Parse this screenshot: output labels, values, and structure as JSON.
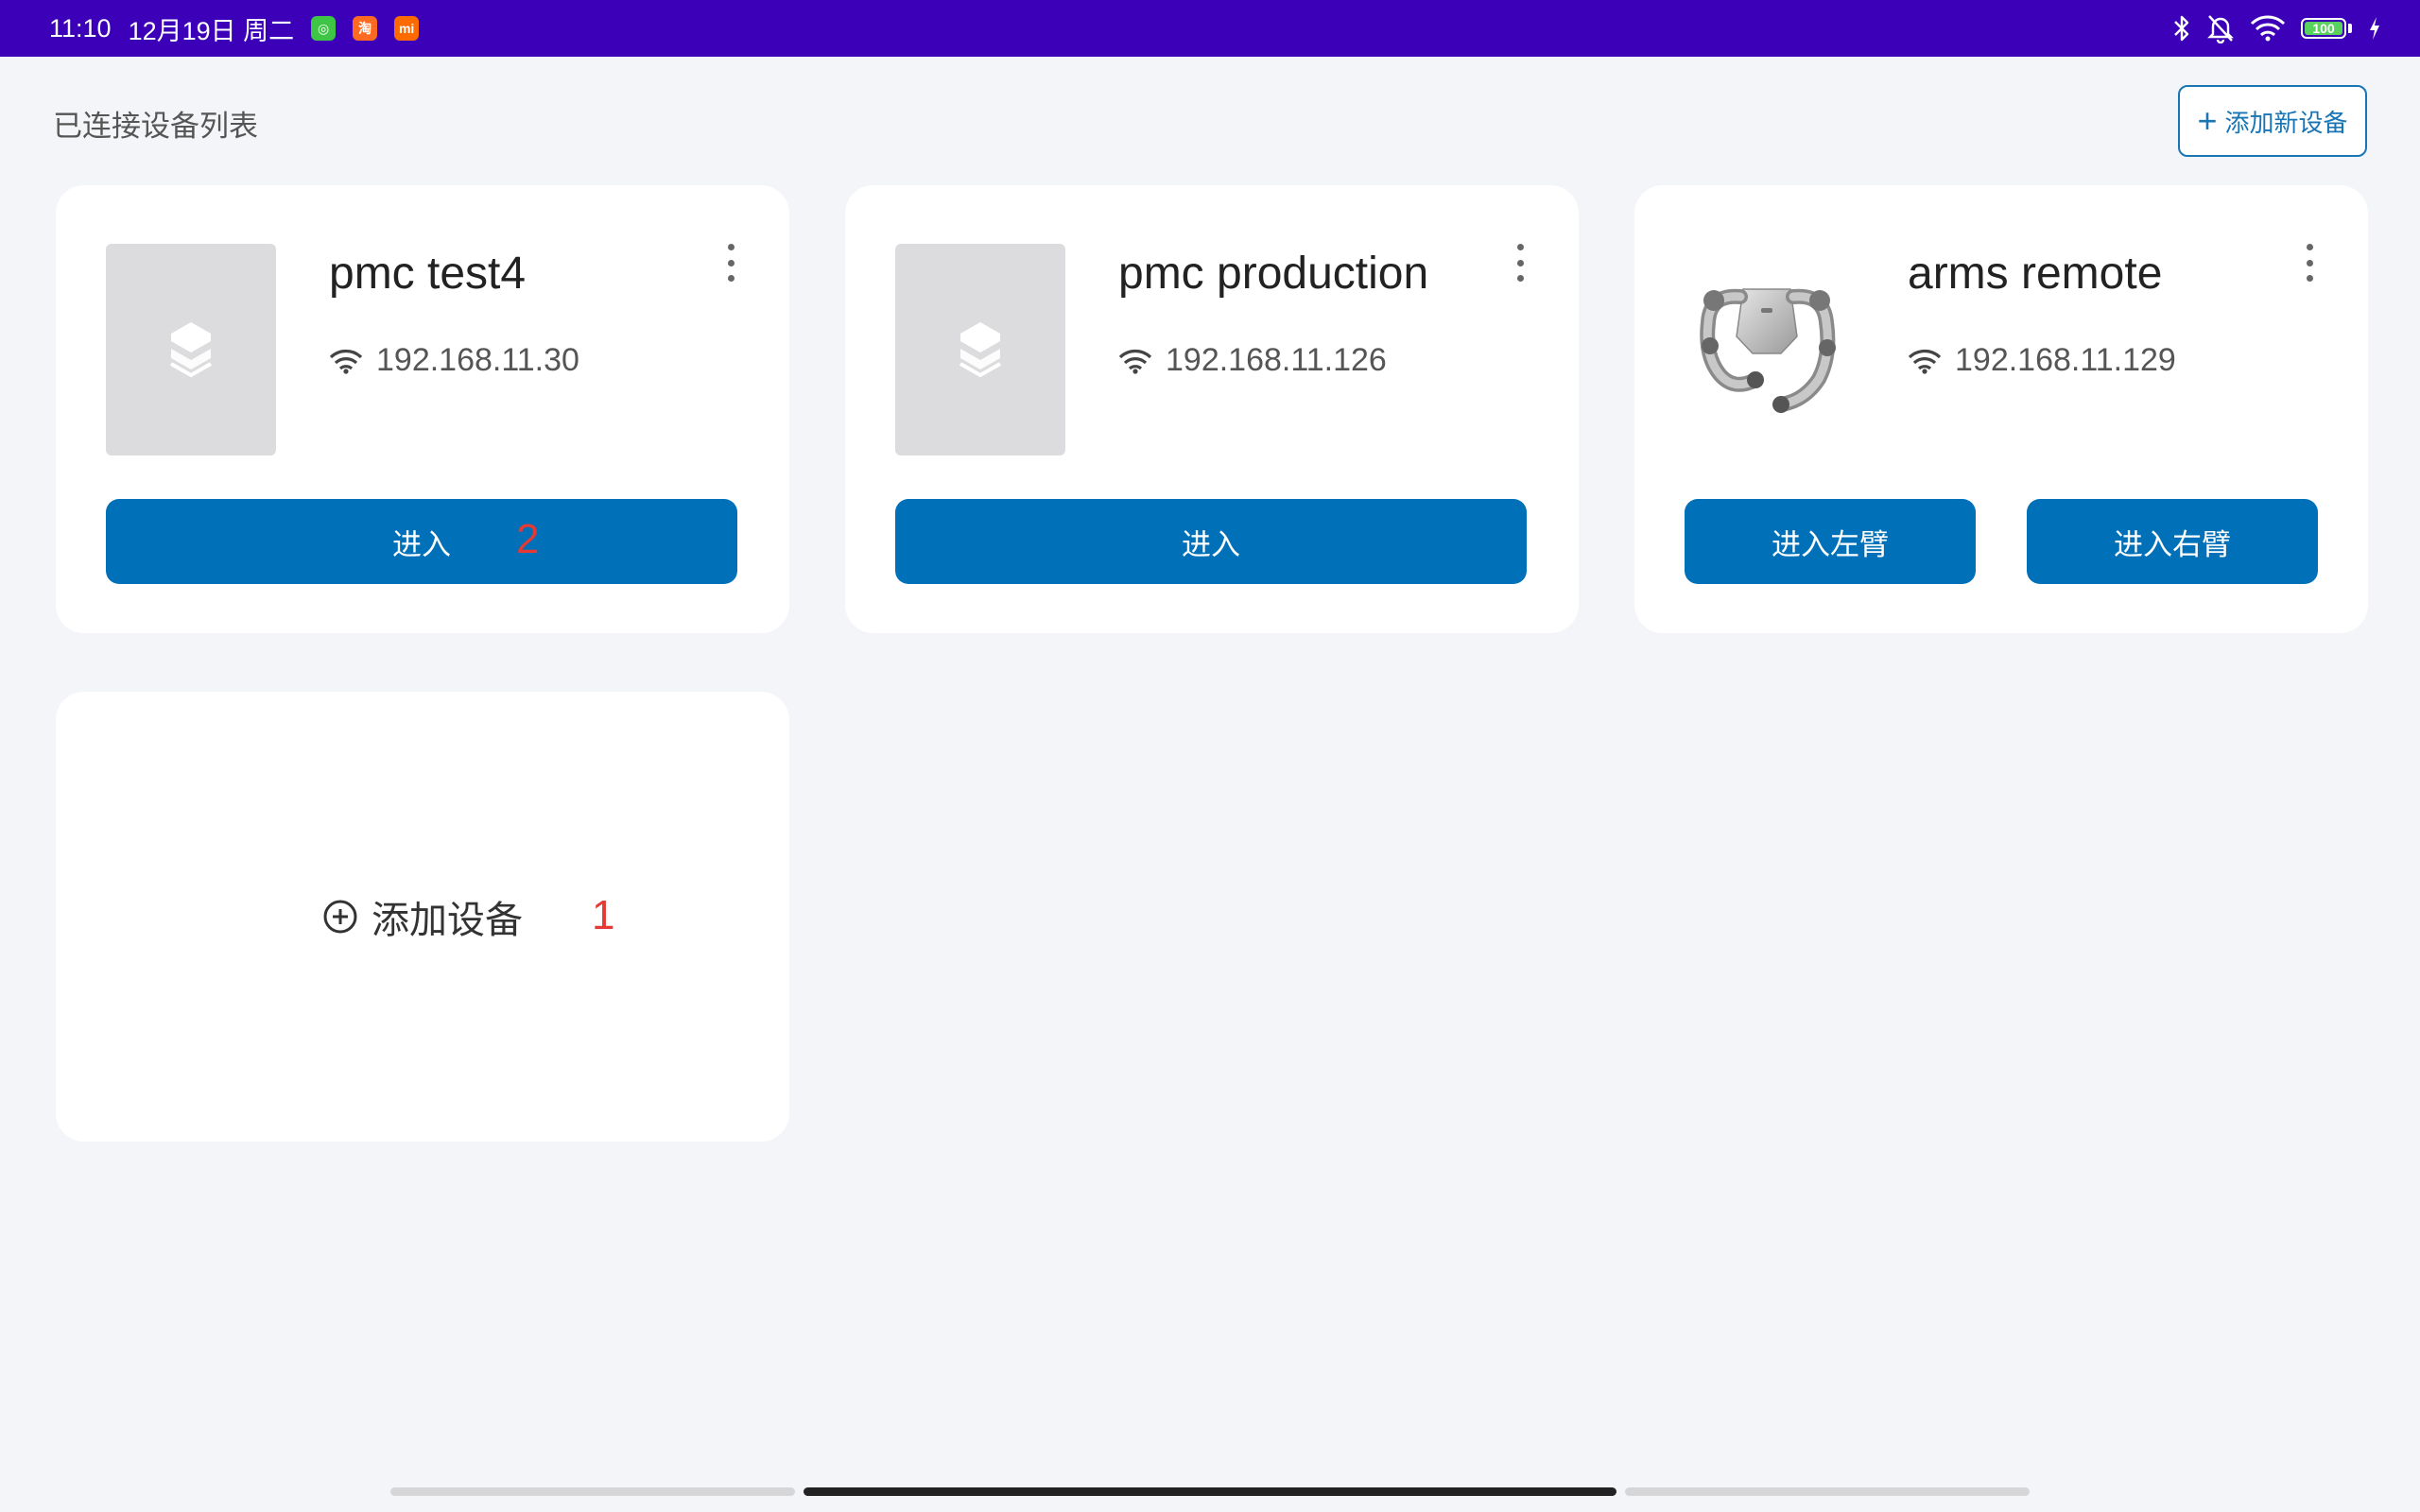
{
  "status_bar": {
    "time": "11:10",
    "date": "12月19日 周二",
    "apps": [
      {
        "icon": "wechat-icon",
        "color": "#3fc546",
        "glyph": "◎"
      },
      {
        "icon": "taobao-icon",
        "color": "#ff6a22",
        "glyph": "淘"
      },
      {
        "icon": "mi-icon",
        "color": "#ff6a00",
        "glyph": "mi"
      }
    ],
    "battery_level": "100"
  },
  "header": {
    "title": "已连接设备列表",
    "add_new_label": "添加新设备"
  },
  "devices": [
    {
      "name": "pmc test4",
      "ip": "192.168.11.30",
      "enter_label": "进入",
      "annotation": "2"
    },
    {
      "name": "pmc production",
      "ip": "192.168.11.126",
      "enter_label": "进入"
    },
    {
      "name": "arms remote",
      "ip": "192.168.11.129",
      "enter_left_label": "进入左臂",
      "enter_right_label": "进入右臂"
    }
  ],
  "add_card": {
    "label": "添加设备",
    "annotation": "1"
  },
  "colors": {
    "status_bar": "#3c00b9",
    "primary": "#0070b8",
    "background": "#f4f5f9",
    "annotation": "#e53935"
  }
}
